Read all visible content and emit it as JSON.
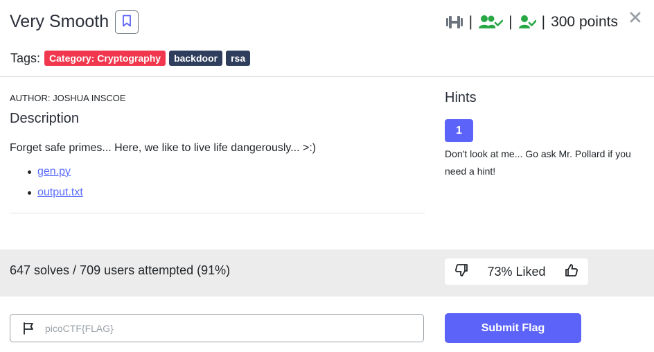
{
  "challenge": {
    "title": "Very Smooth",
    "points": "300 points",
    "separator": "|"
  },
  "tags": {
    "label": "Tags:",
    "items": [
      "Category: Cryptography",
      "backdoor",
      "rsa"
    ]
  },
  "description": {
    "author": "AUTHOR: JOSHUA INSCOE",
    "heading": "Description",
    "text": "Forget safe primes... Here, we like to live life dangerously... >:)",
    "files": [
      "gen.py",
      "output.txt"
    ]
  },
  "hints": {
    "heading": "Hints",
    "items": [
      {
        "number": "1",
        "text": "Don't look at me... Go ask Mr. Pollard if you need a hint!"
      }
    ]
  },
  "stats": {
    "solves_text": "647 solves / 709 users attempted (91%)",
    "liked_text": "73% Liked"
  },
  "flag_form": {
    "placeholder": "picoCTF{FLAG}",
    "value": "",
    "submit_label": "Submit Flag"
  },
  "icons": {
    "difficulty": "dumbbell-icon",
    "solved_users": "users-check-icon",
    "solved_self": "user-check-icon",
    "bookmark": "bookmark-icon",
    "close": "close-icon",
    "thumbs_down": "thumbs-down-icon",
    "thumbs_up": "thumbs-up-icon",
    "flag": "flag-icon"
  },
  "colors": {
    "accent": "#5c63f8",
    "danger_tag": "#f0374d",
    "dark_tag": "#2f3e5c",
    "success": "#28a745",
    "muted_icon": "#6c757d"
  }
}
